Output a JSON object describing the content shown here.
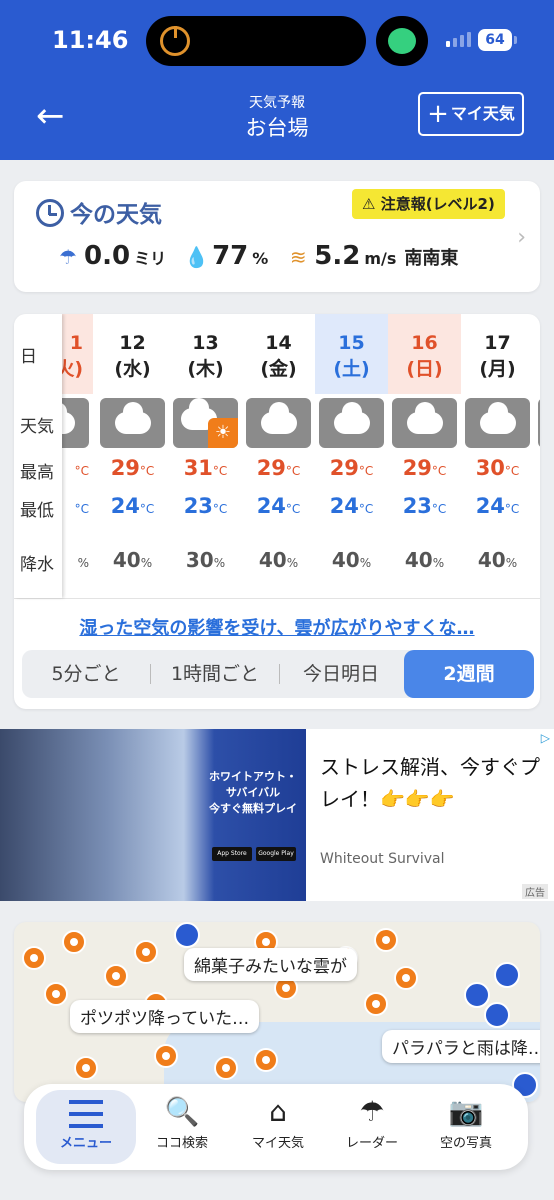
{
  "status": {
    "time": "11:46",
    "battery": "64"
  },
  "header": {
    "subtitle": "天気予報",
    "title": "お台場",
    "back_icon": "arrow-left-icon",
    "my_weather_label": "マイ天気"
  },
  "now": {
    "title": "今の天気",
    "warning": "注意報(レベル2)",
    "precip_value": "0.0",
    "precip_unit": "ミリ",
    "humidity_value": "77",
    "humidity_unit": "%",
    "wind_value": "5.2",
    "wind_unit": "m/s",
    "wind_dir": "南南東"
  },
  "forecast": {
    "row_labels": {
      "day": "日",
      "weather": "天気",
      "high": "最高",
      "low": "最低",
      "rain": "降水"
    },
    "partial_first": {
      "date": "1",
      "dow": "火)",
      "hi": "°C",
      "lo": "°C",
      "rain": "%"
    },
    "days": [
      {
        "date": "12",
        "dow": "(水)",
        "hi": "29",
        "lo": "24",
        "rain": "40",
        "weather": "cloudy"
      },
      {
        "date": "13",
        "dow": "(木)",
        "hi": "31",
        "lo": "23",
        "rain": "30",
        "weather": "cloudy-then-sunny"
      },
      {
        "date": "14",
        "dow": "(金)",
        "hi": "29",
        "lo": "24",
        "rain": "40",
        "weather": "cloudy"
      },
      {
        "date": "15",
        "dow": "(土)",
        "hi": "29",
        "lo": "24",
        "rain": "40",
        "weather": "cloudy"
      },
      {
        "date": "16",
        "dow": "(日)",
        "hi": "29",
        "lo": "23",
        "rain": "40",
        "weather": "cloudy"
      },
      {
        "date": "17",
        "dow": "(月)",
        "hi": "30",
        "lo": "24",
        "rain": "40",
        "weather": "cloudy"
      }
    ],
    "temp_unit": "°C",
    "rain_unit": "%",
    "message": "湿った空気の影響を受け、雲が広がりやすくな…",
    "tabs": [
      "5分ごと",
      "1時間ごと",
      "今日明日",
      "2週間"
    ],
    "active_tab": "2週間"
  },
  "ad": {
    "logo_text": "ホワイトアウト・サバイバル",
    "cta": "今すぐ無料プレイ",
    "store1": "App Store",
    "store2": "Google Play",
    "text": "ストレス解消、今すぐプレイ！👉👉👉",
    "brand": "Whiteout Survival",
    "label": "広告"
  },
  "map": {
    "bubbles": [
      "綿菓子みたいな雲が",
      "ポツポツ降っていた…",
      "パラパラと雨は降…"
    ]
  },
  "tabbar": [
    {
      "label": "メニュー",
      "icon": "menu-icon"
    },
    {
      "label": "ココ検索",
      "icon": "search-icon"
    },
    {
      "label": "マイ天気",
      "icon": "home-icon"
    },
    {
      "label": "レーダー",
      "icon": "umbrella-icon"
    },
    {
      "label": "空の写真",
      "icon": "camera-icon"
    }
  ],
  "colors": {
    "brand_blue": "#2a5bd0",
    "high_temp": "#e0512a",
    "low_temp": "#2a6fdb",
    "warning_yellow": "#f5e733"
  }
}
